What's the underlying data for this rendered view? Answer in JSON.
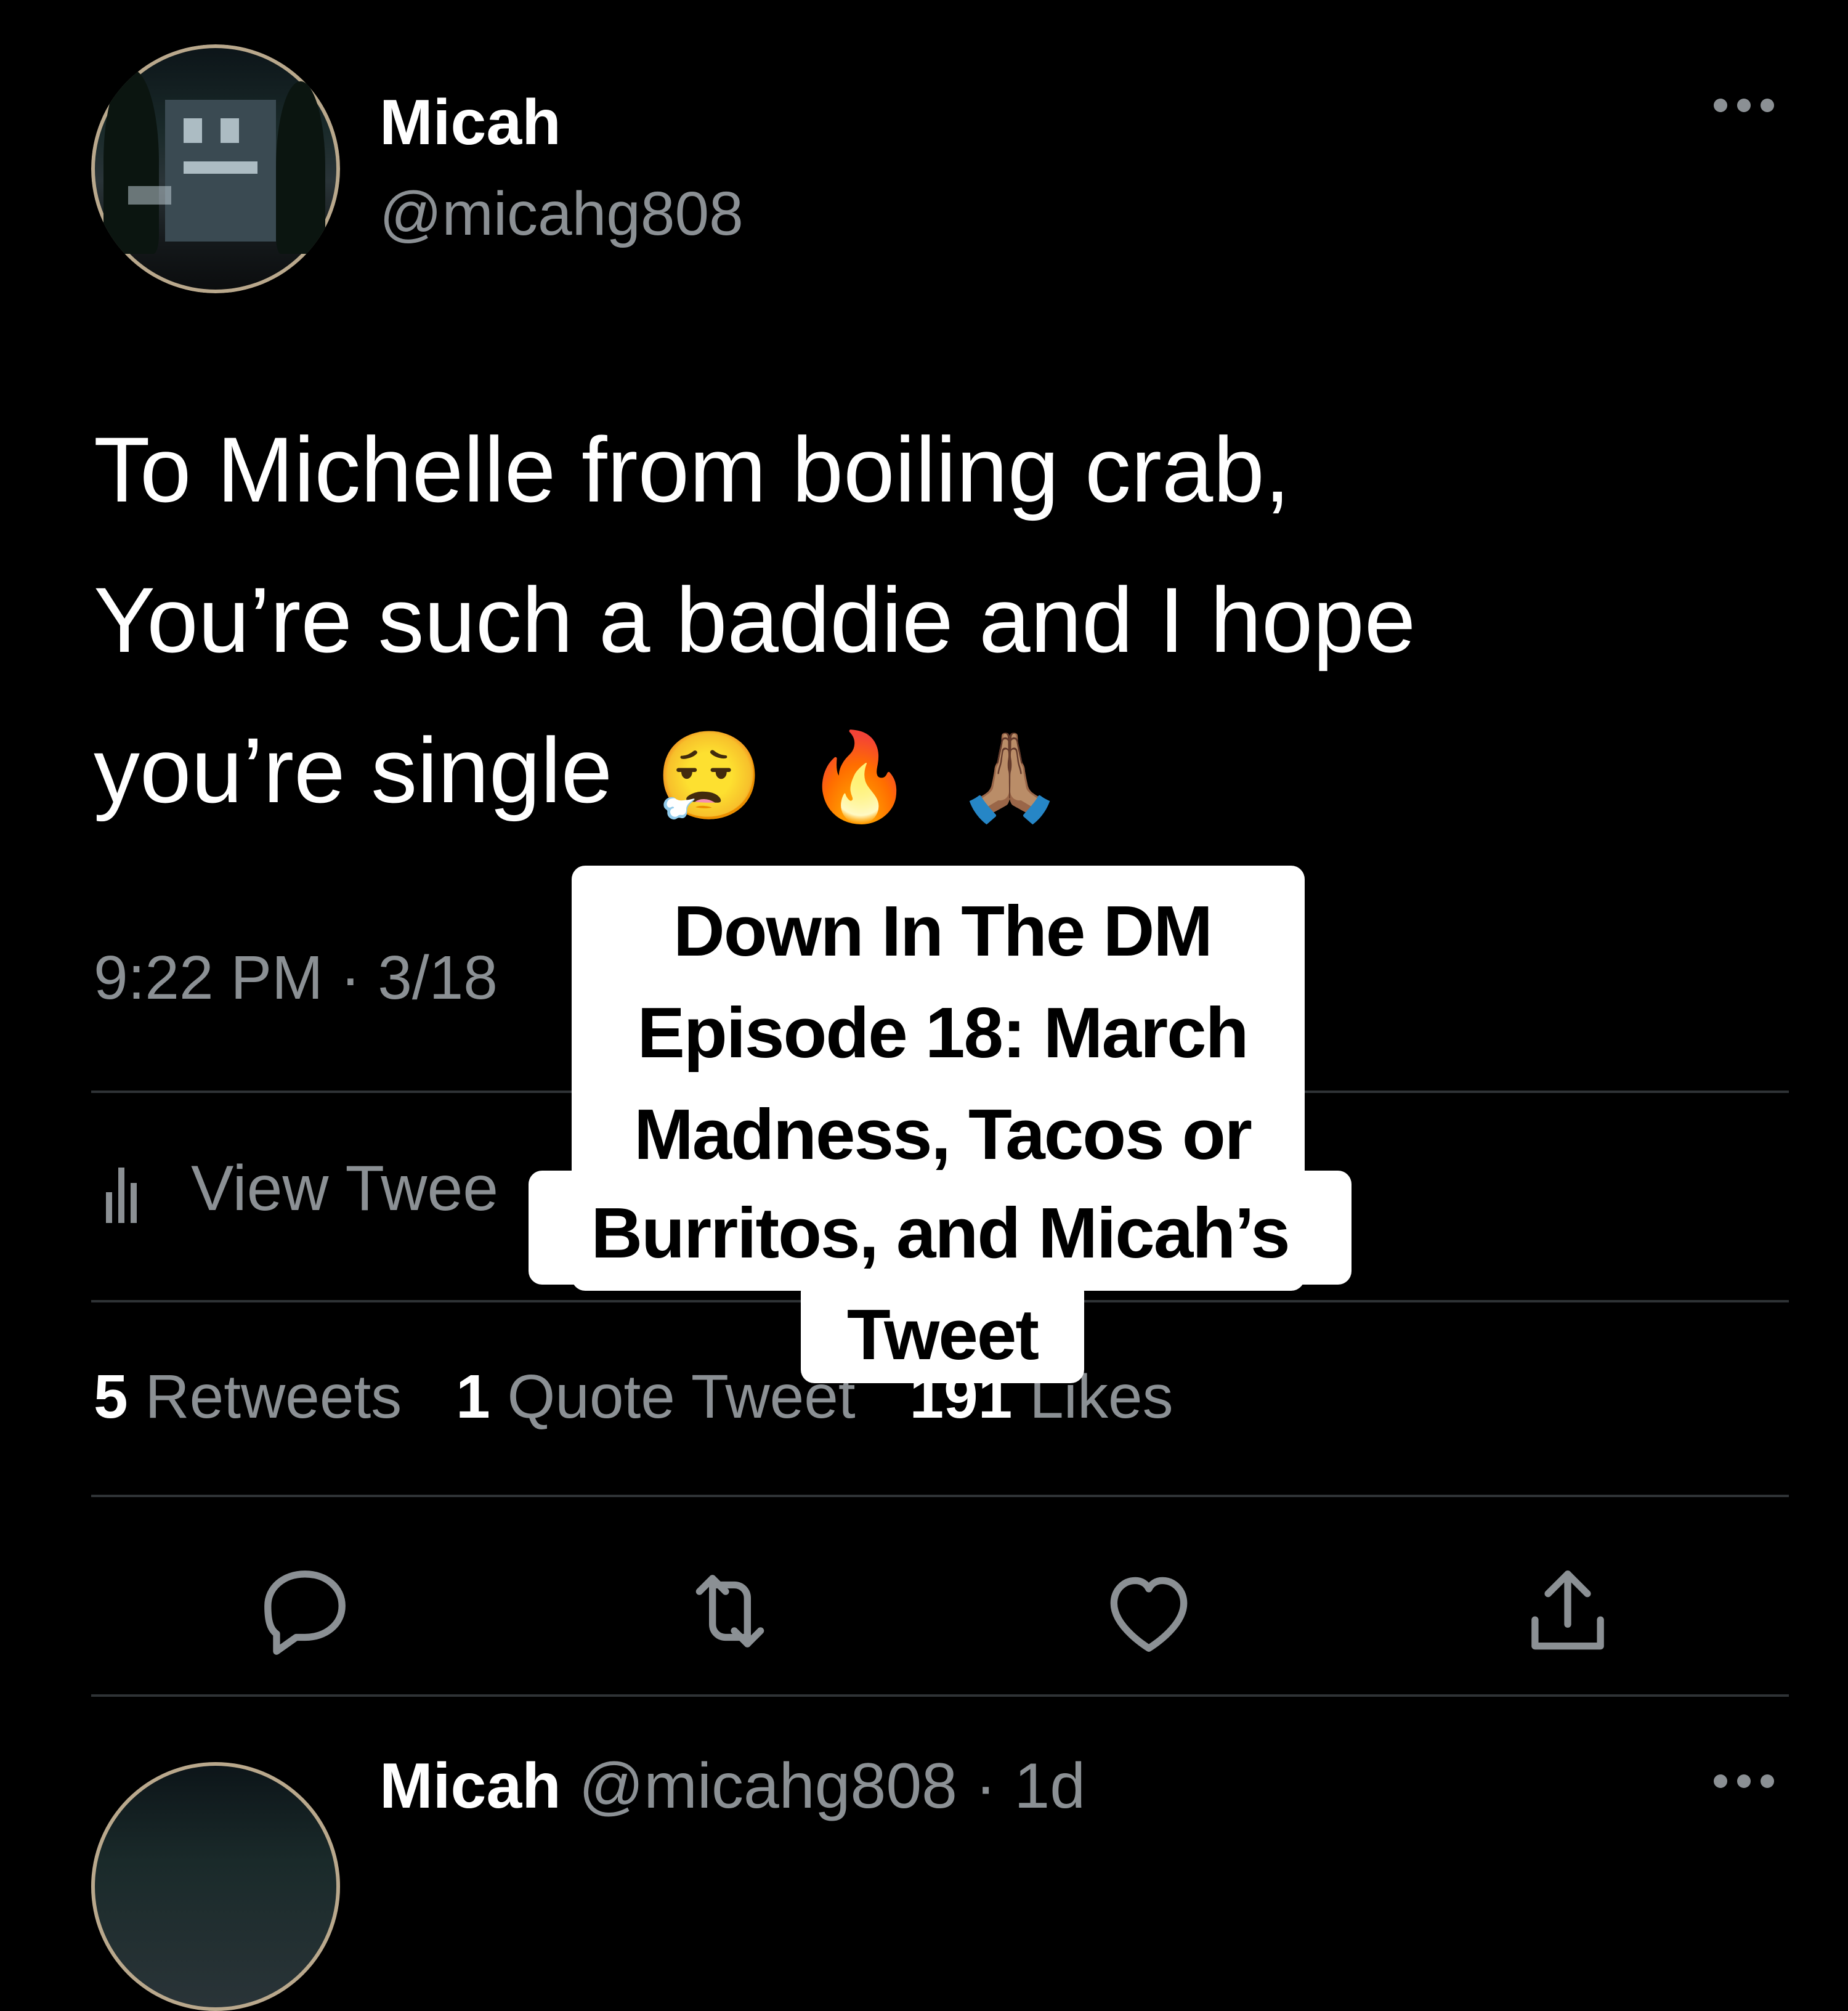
{
  "tweet": {
    "author_name": "Micah",
    "author_handle": "@micahg808",
    "text_lines": [
      "To Michelle from boiling crab,",
      "You’re such a baddie and I hope",
      "you’re single"
    ],
    "emojis": [
      "😮‍💨",
      "🔥",
      "🙏🏽"
    ],
    "timestamp_visible": "9:22 PM · 3/18",
    "view_activity_visible": "View Twee",
    "stats": [
      {
        "count": "5",
        "label": "Retweets"
      },
      {
        "count": "1",
        "label": "Quote Tweet"
      },
      {
        "count": "191",
        "label": "Likes"
      }
    ],
    "actions": [
      {
        "icon": "reply-icon"
      },
      {
        "icon": "retweet-icon"
      },
      {
        "icon": "like-icon"
      },
      {
        "icon": "share-icon"
      }
    ]
  },
  "reply": {
    "author_name": "Micah",
    "author_handle": "@micahg808",
    "age": "· 1d"
  },
  "overlay_caption": {
    "lines": [
      "Down In The DM",
      "Episode 18: March",
      "Madness, Tacos or",
      "Burritos, and Micah’s",
      "Tweet"
    ]
  },
  "colors": {
    "background": "#000000",
    "primary_text": "#ffffff",
    "secondary_text": "#8b9094",
    "divider": "#2f3336",
    "caption_bg": "#ffffff"
  }
}
